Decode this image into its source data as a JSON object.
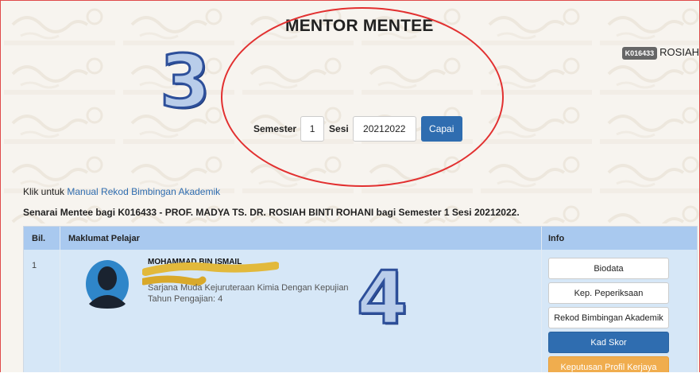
{
  "header": {
    "title": "MENTOR MENTEE",
    "staff_id": "K016433",
    "staff_name": "ROSIAH"
  },
  "annotations": {
    "step3": "3",
    "step4": "4"
  },
  "filter": {
    "semester_label": "Semester",
    "semester_value": "1",
    "sesi_label": "Sesi",
    "sesi_value": "20212022",
    "submit_label": "Capai"
  },
  "manual": {
    "prefix": "Klik untuk ",
    "link": "Manual Rekod Bimbingan Akademik"
  },
  "list_title": "Senarai Mentee bagi K016433 - PROF. MADYA TS. DR. ROSIAH BINTI ROHANI bagi Semester 1 Sesi 20212022.",
  "table": {
    "headers": {
      "bil": "Bil.",
      "info_pelajar": "Maklumat Pelajar",
      "info": "Info"
    },
    "rows": [
      {
        "bil": "1",
        "name": "MOHAMMAD  BIN ISMAIL",
        "program": "Sarjana Muda Kejuruteraan Kimia Dengan Kepujian",
        "year": "Tahun Pengajian: 4",
        "actions": {
          "biodata": "Biodata",
          "peperiksaan": "Kep. Peperiksaan",
          "rekod": "Rekod Bimbingan Akademik",
          "kad_skor": "Kad Skor",
          "profil": "Keputusan Profil Kerjaya"
        }
      }
    ]
  },
  "colors": {
    "accent": "#2f6db0",
    "warning": "#f0ad4e",
    "table_header": "#a9c9ef",
    "table_row": "#d6e7f7",
    "highlight_ellipse": "#e23030"
  }
}
